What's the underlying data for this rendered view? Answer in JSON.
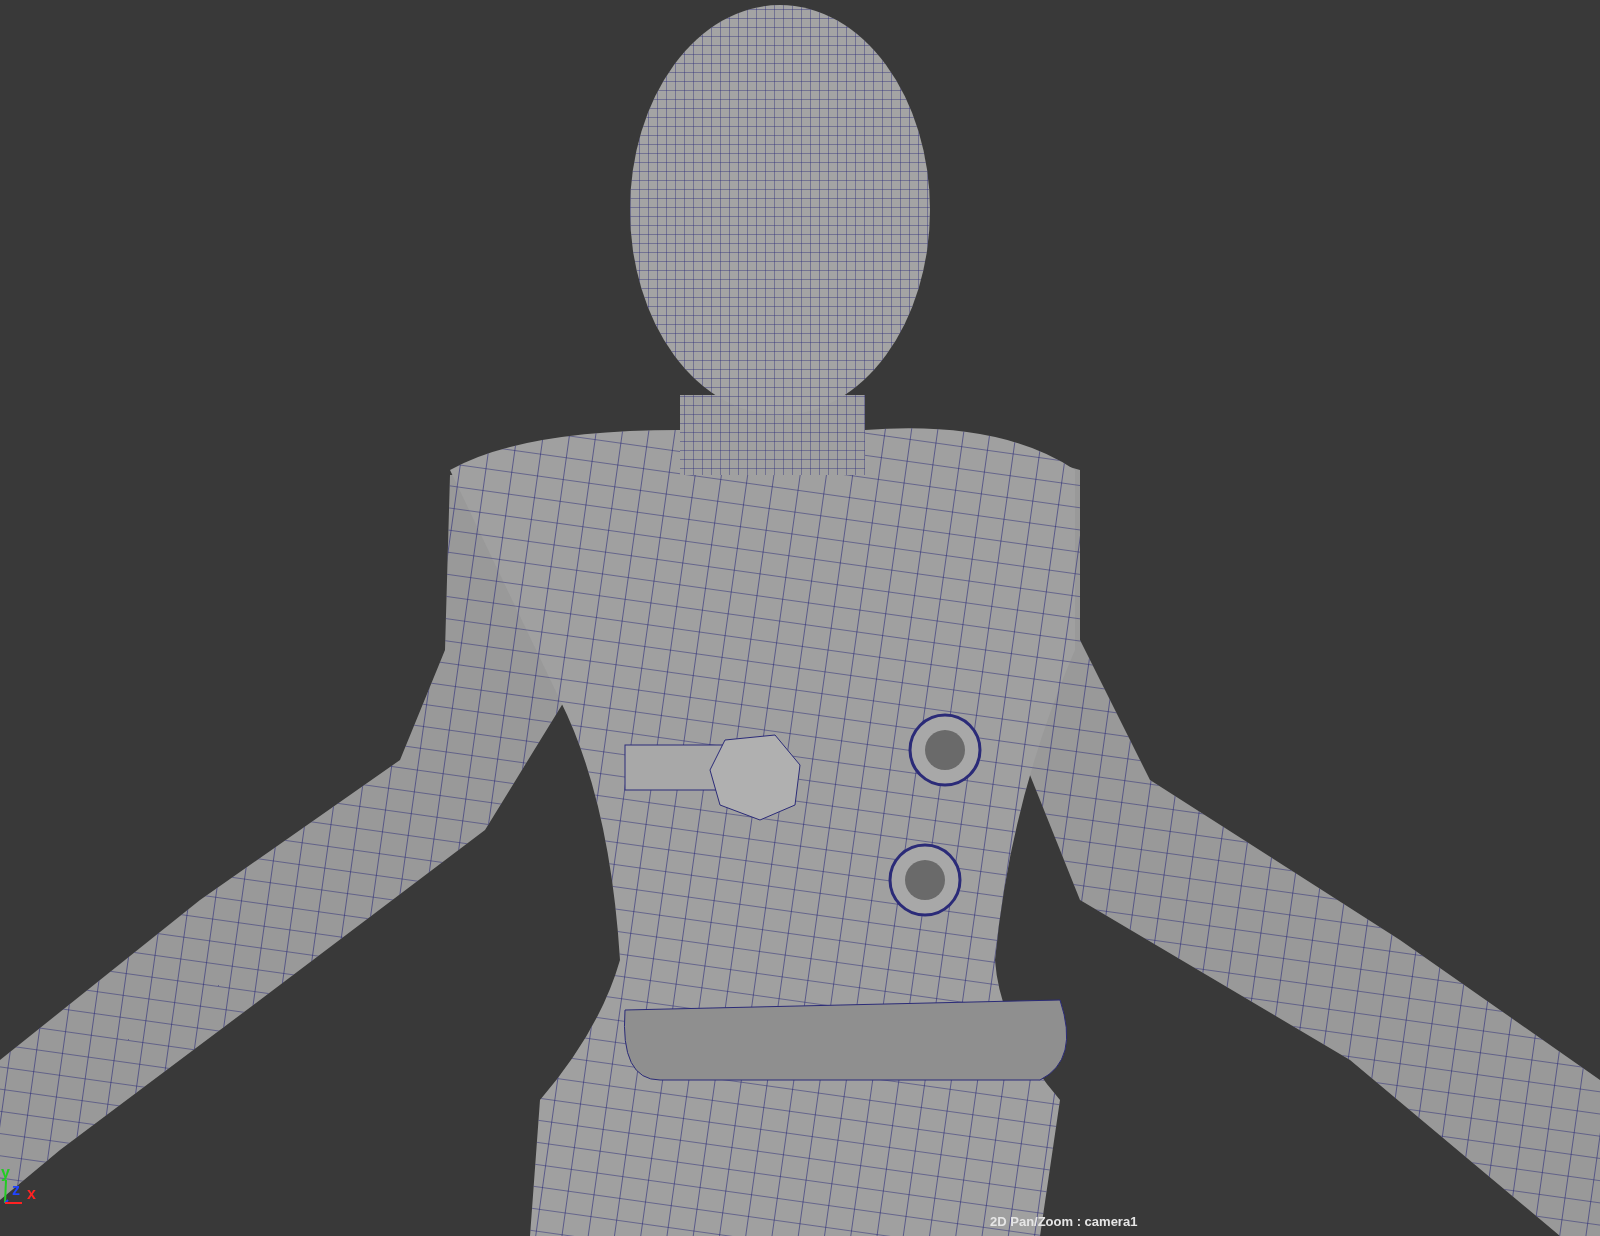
{
  "viewport": {
    "hud_label": "2D Pan/Zoom : camera1",
    "axes": [
      {
        "label": "y",
        "color": "#22cc22"
      },
      {
        "label": "z",
        "color": "#2244ff"
      },
      {
        "label": "x",
        "color": "#ff2222"
      }
    ]
  }
}
